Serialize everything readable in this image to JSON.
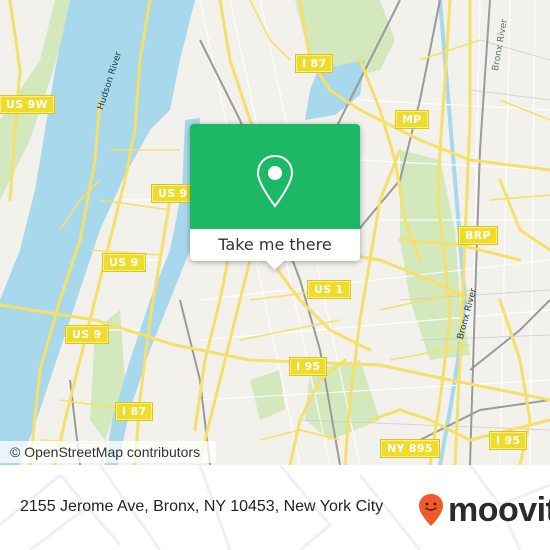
{
  "map": {
    "water_labels": [
      {
        "text": "Hudson River"
      },
      {
        "text": "Bronx River"
      },
      {
        "text": "Bronx River"
      }
    ],
    "shields": [
      {
        "text": "US 9W"
      },
      {
        "text": "US 9"
      },
      {
        "text": "US 9"
      },
      {
        "text": "US 9"
      },
      {
        "text": "I 87"
      },
      {
        "text": "I 87"
      },
      {
        "text": "MP"
      },
      {
        "text": "BRP"
      },
      {
        "text": "US 1"
      },
      {
        "text": "I 95"
      },
      {
        "text": "I 95"
      },
      {
        "text": "NY 895"
      }
    ],
    "attribution": "© OpenStreetMap contributors",
    "colors": {
      "land": "#f2f1ec",
      "water": "#a8d8ec",
      "park": "#d4e8bd",
      "road": "#f4e06a",
      "rail": "#9a9a9a"
    }
  },
  "popup": {
    "button_label": "Take me there",
    "icon": "map-pin-icon",
    "color": "#1db866"
  },
  "footer": {
    "address": "2155 Jerome Ave, Bronx, NY 10453, New York City",
    "brand": "moovit",
    "brand_icon": "moovit-smiley-pin-icon",
    "brand_color": "#f05a28"
  }
}
